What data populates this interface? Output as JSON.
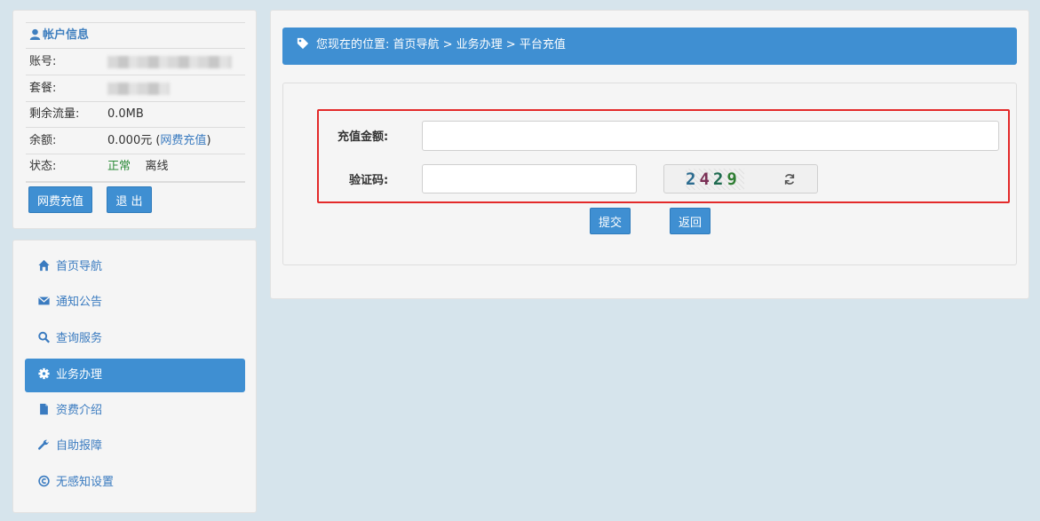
{
  "account": {
    "title": "帐户信息",
    "rows": [
      {
        "label": "账号:",
        "value": ""
      },
      {
        "label": "套餐:",
        "value": ""
      },
      {
        "label": "剩余流量:",
        "value": "0.0MB"
      },
      {
        "label": "余额:",
        "value": "0.000元 (",
        "link": "网费充值",
        "suffix": ")"
      },
      {
        "label": "状态:",
        "value": "正常",
        "value2": "离线"
      }
    ],
    "buttons": {
      "recharge": "网费充值",
      "logout": "退 出"
    }
  },
  "nav": {
    "items": [
      {
        "label": "首页导航",
        "icon": "home-icon"
      },
      {
        "label": "通知公告",
        "icon": "envelope-icon"
      },
      {
        "label": "查询服务",
        "icon": "search-icon"
      },
      {
        "label": "业务办理",
        "icon": "gear-icon",
        "active": true
      },
      {
        "label": "资费介绍",
        "icon": "file-icon"
      },
      {
        "label": "自助报障",
        "icon": "wrench-icon"
      },
      {
        "label": "无感知设置",
        "icon": "copyright-icon"
      }
    ]
  },
  "breadcrumb": {
    "text": "您现在的位置: 首页导航 > 业务办理 > 平台充值",
    "icon": "tag-icon"
  },
  "form": {
    "amount_label": "充值金额:",
    "amount_value": "",
    "captcha_label": "验证码:",
    "captcha_value": "",
    "captcha_chars": [
      "2",
      "4",
      "2",
      "9"
    ],
    "refresh_icon": "refresh-icon",
    "submit": "提交",
    "back": "返回"
  },
  "colors": {
    "accent": "#3f8fd2",
    "highlight": "#e32a2a",
    "background": "#d6e4ec"
  }
}
